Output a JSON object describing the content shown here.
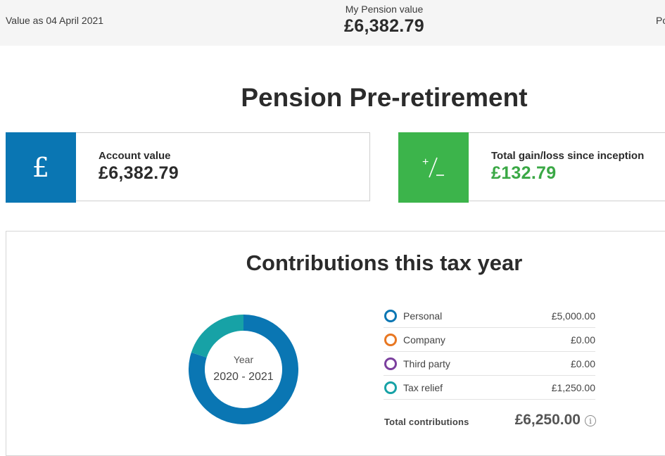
{
  "header": {
    "value_as_of": "Value as 04 April 2021",
    "pension_value_label": "My Pension value",
    "pension_value": "£6,382.79",
    "right_cutoff_text": "Po"
  },
  "page": {
    "title": "Pension Pre-retirement"
  },
  "cards": {
    "account": {
      "icon": "pound-icon",
      "icon_glyph": "£",
      "label": "Account value",
      "value": "£6,382.79",
      "tile_color": "#0a76b3"
    },
    "gain": {
      "icon": "plus-minus-icon",
      "icon_glyph": "+/−",
      "label": "Total gain/loss since inception",
      "value": "£132.79",
      "tile_color": "#3cb44b",
      "value_color": "#3aa845"
    }
  },
  "contributions": {
    "title": "Contributions this tax year",
    "donut": {
      "center_label": "Year",
      "center_value": "2020 - 2021"
    },
    "items": [
      {
        "name": "Personal",
        "amount": "£5,000.00",
        "value": 5000,
        "color": "#0a76b3"
      },
      {
        "name": "Company",
        "amount": "£0.00",
        "value": 0,
        "color": "#e87722"
      },
      {
        "name": "Third party",
        "amount": "£0.00",
        "value": 0,
        "color": "#7b3f9e"
      },
      {
        "name": "Tax relief",
        "amount": "£1,250.00",
        "value": 1250,
        "color": "#17a2a6"
      }
    ],
    "total_label": "Total contributions",
    "total_value": "£6,250.00",
    "info_icon": "info-icon"
  }
}
